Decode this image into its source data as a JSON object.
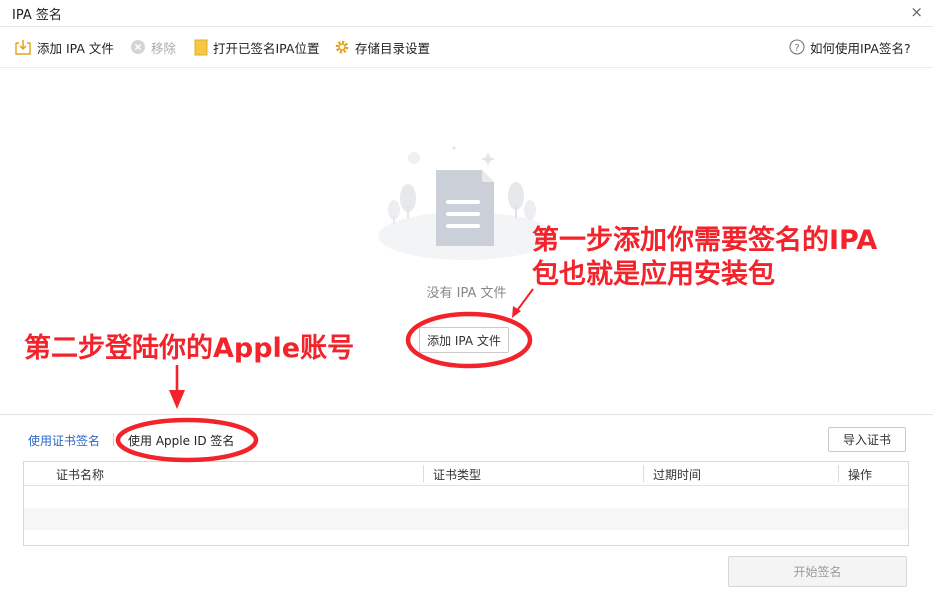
{
  "window": {
    "title": "IPA 签名",
    "close_glyph": "×"
  },
  "toolbar": {
    "add_ipa": {
      "label": "添加 IPA 文件",
      "icon": "add-file-icon"
    },
    "remove": {
      "label": "移除",
      "icon": "remove-circle-icon",
      "disabled": true
    },
    "open_folder": {
      "label": "打开已签名IPA位置",
      "icon": "folder-icon"
    },
    "storage_settings": {
      "label": "存储目录设置",
      "icon": "gear-icon"
    },
    "help": {
      "label": "如何使用IPA签名?",
      "icon": "question-circle-icon"
    }
  },
  "empty_state": {
    "message": "没有 IPA 文件",
    "add_button": "添加 IPA 文件",
    "icon": "document-icon"
  },
  "annotations": {
    "step1_line1": "第一步添加你需要签名的IPA",
    "step1_line2": "包也就是应用安装包",
    "step2": "第二步登陆你的Apple账号",
    "color": "#f2232a"
  },
  "tabs": {
    "cert_sign": "使用证书签名",
    "apple_id_sign": "使用 Apple ID 签名"
  },
  "import_button": "导入证书",
  "table": {
    "columns": [
      "证书名称",
      "证书类型",
      "过期时间",
      "操作"
    ]
  },
  "start_button": "开始签名",
  "colors": {
    "link_blue": "#2b67c4",
    "folder_yellow": "#f6c745",
    "annotation_red": "#f2232a"
  }
}
